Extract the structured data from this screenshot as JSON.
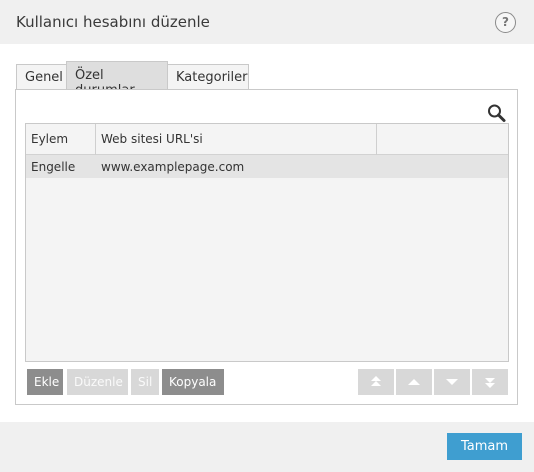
{
  "window": {
    "title": "Kullanıcı hesabını düzenle",
    "help_symbol": "?"
  },
  "tabs": [
    {
      "label": "Genel",
      "active": false
    },
    {
      "label": "Özel durumlar",
      "active": true
    },
    {
      "label": "Kategoriler",
      "active": false
    }
  ],
  "table": {
    "columns": [
      "Eylem",
      "Web sitesi URL'si"
    ],
    "rows": [
      {
        "action": "Engelle",
        "url": "www.examplepage.com"
      }
    ]
  },
  "buttons": {
    "add": "Ekle",
    "edit": "Düzenle",
    "delete": "Sil",
    "copy": "Kopyala",
    "ok": "Tamam"
  },
  "icons": {
    "search": "search-icon",
    "move_top": "double-up-arrow-icon",
    "move_up": "up-arrow-icon",
    "move_down": "down-arrow-icon",
    "move_bottom": "double-down-arrow-icon"
  },
  "colors": {
    "accent": "#3f9ed0",
    "button_dark": "#8d8d8d",
    "button_disabled": "#d8d8d8",
    "selected_row": "#e4e4e4"
  }
}
